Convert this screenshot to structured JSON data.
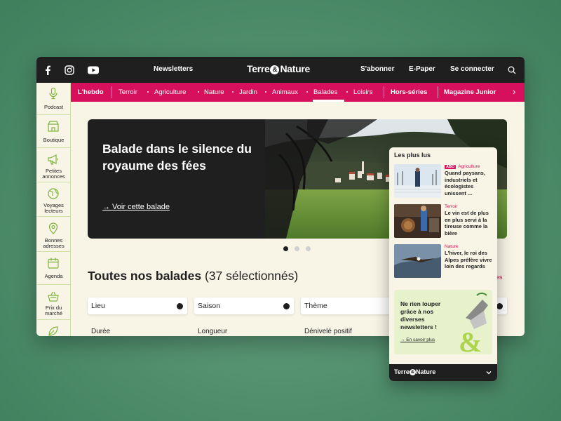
{
  "topbar": {
    "social": [
      "facebook-icon",
      "instagram-icon",
      "youtube-icon"
    ],
    "newsletters": "Newsletters",
    "logo_left": "Terre",
    "logo_amp": "&",
    "logo_right": "Nature",
    "subscribe": "S'abonner",
    "epaper": "E-Paper",
    "login": "Se connecter"
  },
  "sidebar": {
    "items": [
      {
        "label": "Podcast",
        "icon": "microphone-icon"
      },
      {
        "label": "Boutique",
        "icon": "shop-icon"
      },
      {
        "label": "Petites annonces",
        "icon": "megaphone-icon"
      },
      {
        "label": "Voyages lecteurs",
        "icon": "globe-icon"
      },
      {
        "label": "Bonnes adresses",
        "icon": "map-pin-icon"
      },
      {
        "label": "Agenda",
        "icon": "calendar-icon"
      },
      {
        "label": "Prix du marché",
        "icon": "basket-icon"
      }
    ]
  },
  "nav": {
    "hebdo": "L'hebdo",
    "items": [
      "Terroir",
      "Agriculture",
      "Nature",
      "Jardin",
      "Animaux",
      "Balades",
      "Loisirs"
    ],
    "active": "Balades",
    "hors_series": "Hors-séries",
    "junior": "Magazine Junior"
  },
  "hero": {
    "title": "Balade dans le silence du royaume des fées",
    "link": "→ Voir cette balade"
  },
  "carousel": {
    "active_index": 0,
    "count": 3
  },
  "listing": {
    "title_bold": "Toutes nos balades",
    "title_count": " (37 sélectionnés)",
    "filters": [
      "Lieu",
      "Saison",
      "Thème",
      ""
    ],
    "sub_filters": [
      "Durée",
      "Longueur",
      "Dénivelé positif"
    ],
    "reset": "res"
  },
  "mobile": {
    "section_title": "Les plus lus",
    "articles": [
      {
        "badge": "ABO",
        "tag": "Agriculture",
        "title": "Quand paysans, industriels et écologistes unissent ..."
      },
      {
        "badge": "",
        "tag": "Terroir",
        "title": "Le vin est de plus en plus servi à la tireuse comme la bière"
      },
      {
        "badge": "",
        "tag": "Nature",
        "title": "L'hiver, le roi des Alpes préfère vivre loin des regards"
      }
    ],
    "promo": {
      "text": "Ne rien louper grâce à nos diverses newsletters !",
      "link": "→ En savoir plus"
    },
    "footer_logo_left": "Terre",
    "footer_logo_amp": "&",
    "footer_logo_right": "Nature"
  },
  "colors": {
    "accent": "#d6105a",
    "dark": "#1f1f1f",
    "background": "#f8f4e6",
    "sidebar_border": "#cfe3a8",
    "promo_bg": "#e7f2cd"
  }
}
